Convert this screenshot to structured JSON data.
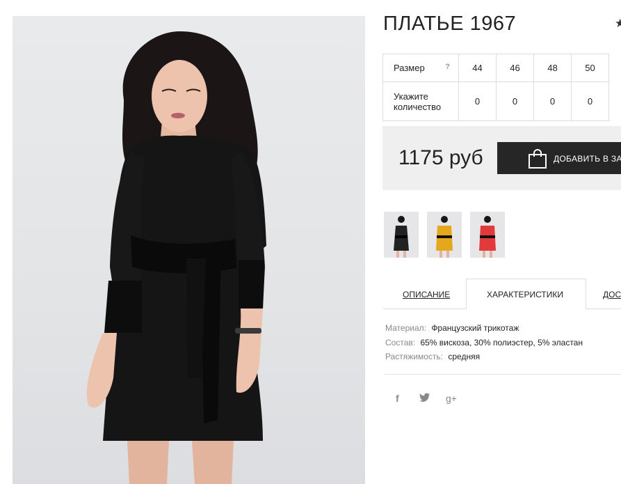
{
  "product": {
    "title": "ПЛАТЬЕ 1967"
  },
  "size_table": {
    "size_label": "Размер",
    "help_icon_text": "?",
    "qty_label": "Укажите количество",
    "sizes": [
      "44",
      "46",
      "48",
      "50"
    ],
    "quantities": [
      "0",
      "0",
      "0",
      "0"
    ]
  },
  "price": {
    "amount": "1175 руб",
    "cart_button_label": "ДОБАВИТЬ В ЗАКАЗ"
  },
  "thumbnails": [
    {
      "name": "black",
      "color": "#222222"
    },
    {
      "name": "yellow",
      "color": "#e5a81c"
    },
    {
      "name": "red",
      "color": "#e23a3a"
    }
  ],
  "tabs": {
    "description": "ОПИСАНИЕ",
    "characteristics": "ХАРАКТЕРИСТИКИ",
    "delivery": "ДОСТАВКА"
  },
  "specs": [
    {
      "key": "Материал:",
      "value": "Французский трикотаж"
    },
    {
      "key": "Состав:",
      "value": "65% вискоза, 30% полиэстер, 5% эластан"
    },
    {
      "key": "Растяжимость:",
      "value": "средняя"
    }
  ],
  "social": {
    "facebook": "f",
    "twitter": "twitter",
    "google": "g+"
  },
  "colors": {
    "button_bg": "#262626",
    "price_bg": "#efefef",
    "border": "#dcdcdc"
  }
}
